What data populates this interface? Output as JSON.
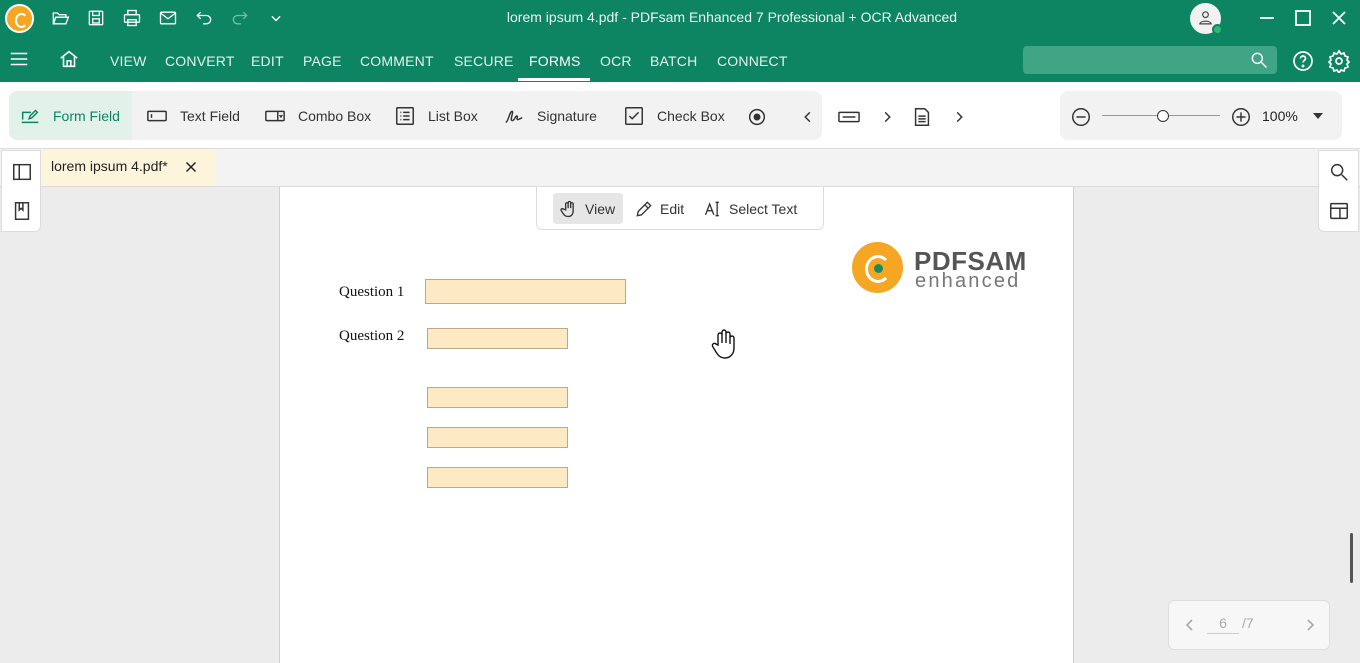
{
  "titlebar": {
    "title": "lorem ipsum 4.pdf  -  PDFsam Enhanced 7 Professional + OCR Advanced",
    "quick_access": [
      "open-icon",
      "save-icon",
      "print-icon",
      "email-icon",
      "undo-icon",
      "redo-icon",
      "customize-chevron-icon"
    ]
  },
  "menu": {
    "tabs": [
      {
        "label": "VIEW"
      },
      {
        "label": "CONVERT"
      },
      {
        "label": "EDIT"
      },
      {
        "label": "PAGE"
      },
      {
        "label": "COMMENT"
      },
      {
        "label": "SECURE"
      },
      {
        "label": "FORMS"
      },
      {
        "label": "OCR"
      },
      {
        "label": "BATCH"
      },
      {
        "label": "CONNECT"
      }
    ],
    "active_tab": "FORMS",
    "search_placeholder": ""
  },
  "ribbon": {
    "form_field": "Form Field",
    "text_field": "Text Field",
    "combo_box": "Combo Box",
    "list_box": "List Box",
    "signature": "Signature",
    "check_box": "Check Box",
    "zoom_value": "100%",
    "zoom_level": 1.0
  },
  "doc_tab": {
    "label": "lorem ipsum 4.pdf*"
  },
  "mode_bar": {
    "view": "View",
    "edit": "Edit",
    "select_text": "Select Text"
  },
  "page": {
    "questions": [
      {
        "label": "Question 1"
      },
      {
        "label": "Question 2"
      }
    ],
    "logo": {
      "line1": "PDFSAM",
      "line2": "enhanced"
    }
  },
  "pager": {
    "current": "6",
    "total": "/7"
  },
  "colors": {
    "brand_green": "#0d8563",
    "form_field_fill": "#fde9c4",
    "tab_highlight": "#fdf4dc",
    "logo_orange": "#f5a623"
  }
}
